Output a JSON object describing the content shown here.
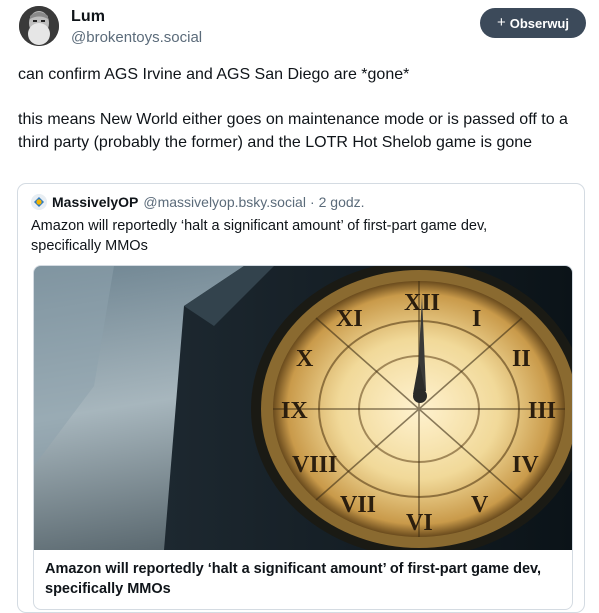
{
  "post": {
    "author": {
      "display_name": "Lum",
      "handle": "@brokentoys.social"
    },
    "follow_button": {
      "plus": "+",
      "label": "Obserwuj"
    },
    "text_line_1": "can confirm AGS Irvine and AGS San Diego are *gone*",
    "text_line_2": "this means New World either goes on maintenance mode or is passed off to a third party (probably the former) and the LOTR Hot Shelob game is gone"
  },
  "quote": {
    "author_name": "MassivelyOP",
    "author_handle": "@massivelyop.bsky.social",
    "separator": "·",
    "time": "2 godz.",
    "text": "Amazon will reportedly ‘halt a significant amount’ of first-part game dev, specifically MMOs",
    "embed": {
      "title": "Amazon will reportedly ‘halt a significant amount’ of first-part game dev, specifically MMOs",
      "image": "clock-tower-image"
    }
  },
  "icons": {
    "avatar": "bearded-man-avatar",
    "quote_avatar": "massivelyop-logo-icon"
  }
}
